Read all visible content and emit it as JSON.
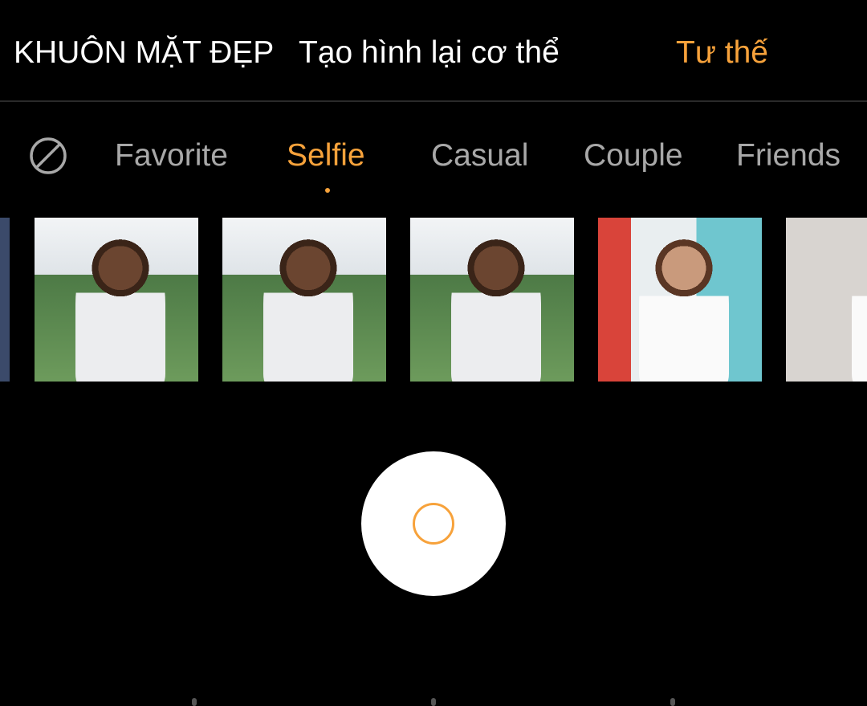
{
  "mode_tabs": [
    {
      "label": "KHUÔN MẶT ĐẸP",
      "active": false
    },
    {
      "label": "Tạo hình lại cơ thể",
      "active": false
    },
    {
      "label": "Tư thế",
      "active": true
    }
  ],
  "categories": {
    "none_icon": "no-filter-icon",
    "items": [
      {
        "label": "Favorite",
        "active": false
      },
      {
        "label": "Selfie",
        "active": true
      },
      {
        "label": "Casual",
        "active": false
      },
      {
        "label": "Couple",
        "active": false
      },
      {
        "label": "Friends",
        "active": false
      }
    ]
  },
  "colors": {
    "accent": "#f7a23b",
    "inactive": "#a8a8a8",
    "background": "#000000"
  },
  "shutter": {
    "icon": "shutter-ring-icon"
  }
}
